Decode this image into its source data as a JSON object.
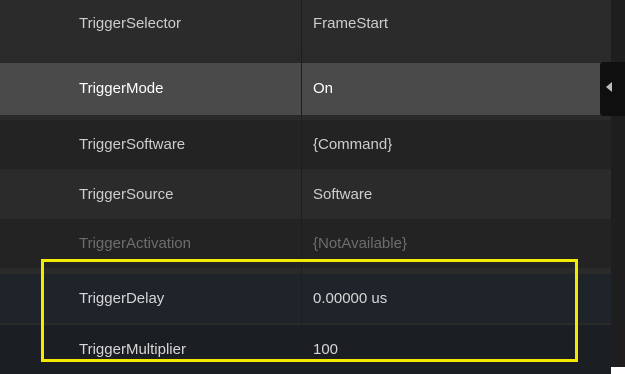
{
  "colors": {
    "panel_bg": "#2a2a2a",
    "selected_row_bg": "#4a4a4a",
    "highlight_border": "#f4ea00"
  },
  "properties": [
    {
      "name": "TriggerSelector",
      "value": "FrameStart"
    },
    {
      "name": "TriggerMode",
      "value": "On"
    },
    {
      "name": "TriggerSoftware",
      "value": "{Command}"
    },
    {
      "name": "TriggerSource",
      "value": "Software"
    },
    {
      "name": "TriggerActivation",
      "value": "{NotAvailable}"
    },
    {
      "name": "TriggerDelay",
      "value": "0.00000 us"
    },
    {
      "name": "TriggerMultiplier",
      "value": "100"
    }
  ],
  "selected_row": "TriggerMode",
  "icons": {
    "scroll_arrow": "caret-left-icon"
  }
}
